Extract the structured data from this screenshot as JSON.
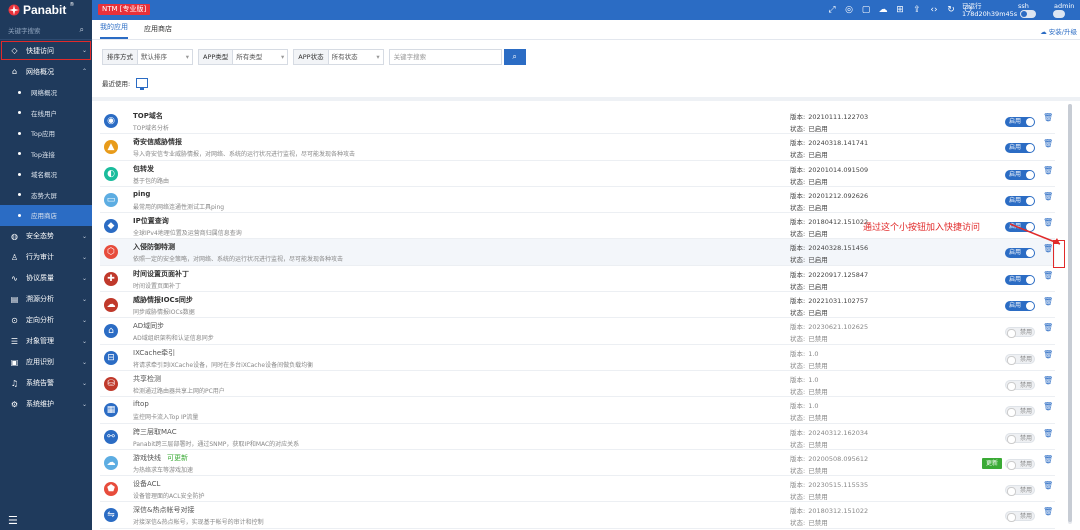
{
  "header": {
    "logo": "Panabit",
    "logo_mark": "®",
    "edition_badge": "NTM [专业版]",
    "uptime_label": "已运行",
    "uptime_value": "178d20h39m45s",
    "user_label": "ssh",
    "admin_label": "admin",
    "icons": [
      "fullscreen-icon",
      "theme-icon",
      "chat-icon",
      "cloud-icon",
      "tree-icon",
      "upload-icon",
      "code-icon",
      "refresh-icon",
      "reboot-icon"
    ]
  },
  "sidebar": {
    "search_placeholder": "关键字搜索",
    "groups": [
      {
        "label": "快捷访问",
        "icon": "gem-icon"
      },
      {
        "label": "网络概况",
        "icon": "home-icon"
      }
    ],
    "sub_items": [
      "网络概况",
      "在线用户",
      "Top应用",
      "Top连接",
      "域名概况",
      "态势大屏",
      "应用商店"
    ],
    "lower_groups": [
      {
        "label": "安全态势",
        "icon": "globe-icon"
      },
      {
        "label": "行为审计",
        "icon": "user-icon"
      },
      {
        "label": "协议质量",
        "icon": "pulse-icon"
      },
      {
        "label": "溯源分析",
        "icon": "chart-icon"
      },
      {
        "label": "定向分析",
        "icon": "pin-icon"
      },
      {
        "label": "对象管理",
        "icon": "list-icon"
      },
      {
        "label": "应用识别",
        "icon": "db-icon"
      },
      {
        "label": "系统告警",
        "icon": "bell-icon"
      },
      {
        "label": "系统维护",
        "icon": "gear-icon"
      }
    ]
  },
  "tabs": {
    "my_apps": "我的应用",
    "app_store": "应用商店",
    "install_upgrade": "安装/升级"
  },
  "filters": {
    "sort_label": "排序方式",
    "sort_value": "默认排序",
    "type_label": "APP类型",
    "type_value": "所有类型",
    "status_label": "APP状态",
    "status_value": "所有状态",
    "search_placeholder": "关键字搜索"
  },
  "recent": {
    "label": "最近使用:"
  },
  "labels": {
    "version": "版本:",
    "status": "状态:",
    "enable": "启用",
    "disable": "禁用",
    "update": "更新",
    "new_update": "可更新"
  },
  "apps": [
    {
      "name": "TOP域名",
      "desc": "TOP域名分析",
      "version": "20210111.122703",
      "status": "已启用",
      "enabled": true,
      "icon": "top-domain-icon",
      "color": "#2b6cc4"
    },
    {
      "name": "奇安信威胁情报",
      "desc": "导入奇安信专业威胁情报，对网络、系统的运行状况进行监视，尽可能发现各种攻击",
      "version": "20240318.141741",
      "status": "已启用",
      "enabled": true,
      "icon": "qianxin-icon",
      "color": "#e89b1a"
    },
    {
      "name": "包转发",
      "desc": "基于包的路由",
      "version": "20201014.091509",
      "status": "已启用",
      "enabled": true,
      "icon": "forward-icon",
      "color": "#1abc9c"
    },
    {
      "name": "ping",
      "desc": "最常用的网络连通性测试工具ping",
      "version": "20201212.092626",
      "status": "已启用",
      "enabled": true,
      "icon": "ping-icon",
      "color": "#5dade2"
    },
    {
      "name": "IP位置查询",
      "desc": "全球IPv4地理位置及运营商归属信息查询",
      "version": "20180412.151022",
      "status": "已启用",
      "enabled": true,
      "icon": "location-icon",
      "color": "#2b6cc4"
    },
    {
      "name": "入侵防御特测",
      "desc": "依照一定的安全策略，对网络、系统的运行状况进行监视，尽可能发现各种攻击",
      "version": "20240328.151456",
      "status": "已启用",
      "enabled": true,
      "icon": "intrusion-icon",
      "color": "#e74c3c"
    },
    {
      "name": "时间设置页面补丁",
      "desc": "时间设置页面补丁",
      "version": "20220917.125847",
      "status": "已启用",
      "enabled": true,
      "icon": "patch-icon",
      "color": "#c0392b"
    },
    {
      "name": "威胁情报IOCs同步",
      "desc": "同步威胁情报IOCs数据",
      "version": "20221031.102757",
      "status": "已启用",
      "enabled": true,
      "icon": "sync-icon",
      "color": "#c0392b"
    },
    {
      "name": "AD域同步",
      "desc": "AD域组织架构和认证信息同步",
      "version": "20230621.102625",
      "status": "已禁用",
      "enabled": false,
      "icon": "ad-icon",
      "color": "#2b6cc4"
    },
    {
      "name": "IXCache牵引",
      "desc": "将请求牵引到IXCache设备，同时在多台iXCache设备间做负载均衡",
      "version": "1.0",
      "status": "已禁用",
      "enabled": false,
      "icon": "cache-icon",
      "color": "#2b6cc4"
    },
    {
      "name": "共享检测",
      "desc": "检测通过路由器共享上网的PC用户",
      "version": "1.0",
      "status": "已禁用",
      "enabled": false,
      "icon": "share-icon",
      "color": "#c0392b"
    },
    {
      "name": "iftop",
      "desc": "监控网卡流入Top IP流量",
      "version": "1.0",
      "status": "已禁用",
      "enabled": false,
      "icon": "iftop-icon",
      "color": "#2b6cc4"
    },
    {
      "name": "跨三层取MAC",
      "desc": "Panabit跨三层部署时，通过SNMP，获取IP和MAC的对应关系",
      "version": "20240312.162034",
      "status": "已禁用",
      "enabled": false,
      "icon": "mac-icon",
      "color": "#2b6cc4"
    },
    {
      "name": "游戏快线",
      "desc": "为热络求车等游戏加速",
      "version": "20200508.095612",
      "status": "已禁用",
      "enabled": false,
      "update": true,
      "icon": "game-icon",
      "color": "#5dade2"
    },
    {
      "name": "设备ACL",
      "desc": "设备管理面的ACL安全防护",
      "version": "20230515.115535",
      "status": "已禁用",
      "enabled": false,
      "icon": "shield-icon",
      "color": "#e74c3c"
    },
    {
      "name": "深信&热点帐号对接",
      "desc": "对接深信&热点帐号，实现基于帐号的审计和控制",
      "version": "20180312.151022",
      "status": "已禁用",
      "enabled": false,
      "icon": "account-icon",
      "color": "#2b6cc4"
    }
  ],
  "annotation": {
    "text": "通过这个小按钮加入快捷访问"
  }
}
